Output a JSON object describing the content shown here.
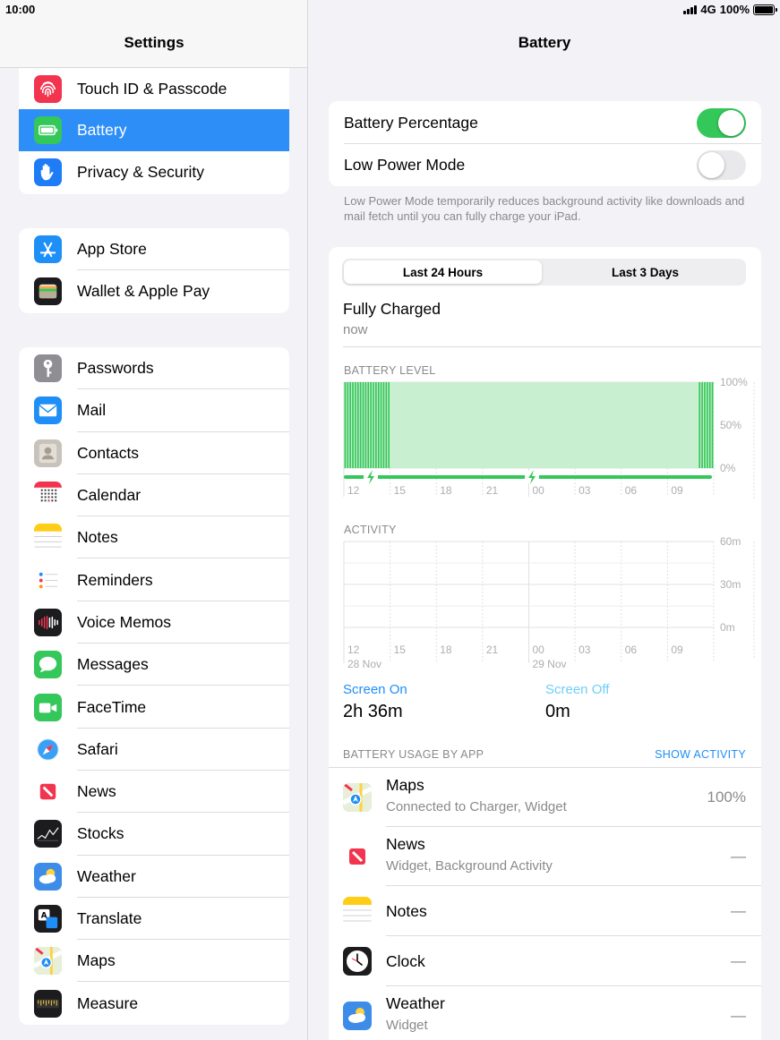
{
  "status_bar": {
    "time": "10:00",
    "network": "4G",
    "battery_percent": "100%"
  },
  "sidebar": {
    "title": "Settings",
    "groups": [
      [
        {
          "label": "Touch ID & Passcode",
          "icon": "fingerprint-icon",
          "color": "#f2344f"
        },
        {
          "label": "Battery",
          "icon": "battery-icon",
          "color": "#34c759",
          "selected": true
        },
        {
          "label": "Privacy & Security",
          "icon": "hand-icon",
          "color": "#1e7cf6"
        }
      ],
      [
        {
          "label": "App Store",
          "icon": "app-store-icon",
          "color": "#1e8ff7"
        },
        {
          "label": "Wallet & Apple Pay",
          "icon": "wallet-icon",
          "color": "#1c1c1e"
        }
      ],
      [
        {
          "label": "Passwords",
          "icon": "key-icon",
          "color": "#8e8e93"
        },
        {
          "label": "Mail",
          "icon": "mail-icon",
          "color": "#1e8ff7"
        },
        {
          "label": "Contacts",
          "icon": "contacts-icon",
          "color": "#c7c3bb"
        },
        {
          "label": "Calendar",
          "icon": "calendar-icon",
          "color": "#ffffff"
        },
        {
          "label": "Notes",
          "icon": "notes-icon",
          "color": "#ffffff"
        },
        {
          "label": "Reminders",
          "icon": "reminders-icon",
          "color": "#ffffff"
        },
        {
          "label": "Voice Memos",
          "icon": "voice-memos-icon",
          "color": "#1c1c1e"
        },
        {
          "label": "Messages",
          "icon": "messages-icon",
          "color": "#34c759"
        },
        {
          "label": "FaceTime",
          "icon": "facetime-icon",
          "color": "#34c759"
        },
        {
          "label": "Safari",
          "icon": "safari-icon",
          "color": "#ffffff"
        },
        {
          "label": "News",
          "icon": "news-icon",
          "color": "#ffffff"
        },
        {
          "label": "Stocks",
          "icon": "stocks-icon",
          "color": "#1c1c1e"
        },
        {
          "label": "Weather",
          "icon": "weather-icon",
          "color": "#3d8de8"
        },
        {
          "label": "Translate",
          "icon": "translate-icon",
          "color": "#1c1c1e"
        },
        {
          "label": "Maps",
          "icon": "maps-icon",
          "color": "#6fd46b"
        },
        {
          "label": "Measure",
          "icon": "measure-icon",
          "color": "#1c1c1e"
        }
      ]
    ]
  },
  "detail": {
    "title": "Battery",
    "battery_percentage_label": "Battery Percentage",
    "battery_percentage_on": true,
    "low_power_label": "Low Power Mode",
    "low_power_on": false,
    "low_power_note": "Low Power Mode temporarily reduces background activity like downloads and mail fetch until you can fully charge your iPad.",
    "segments": [
      "Last 24 Hours",
      "Last 3 Days"
    ],
    "active_segment": 0,
    "charge_status": "Fully Charged",
    "charge_time": "now",
    "battery_level_heading": "BATTERY LEVEL",
    "activity_heading": "ACTIVITY",
    "screen_on_label": "Screen On",
    "screen_on_value": "2h 36m",
    "screen_off_label": "Screen Off",
    "screen_off_value": "0m",
    "usage_heading": "BATTERY USAGE BY APP",
    "show_activity": "SHOW ACTIVITY",
    "apps": [
      {
        "name": "Maps",
        "desc": "Connected to Charger, Widget",
        "value": "100%",
        "icon": "maps-icon"
      },
      {
        "name": "News",
        "desc": "Widget, Background Activity",
        "value": "—",
        "icon": "news-icon"
      },
      {
        "name": "Notes",
        "desc": "",
        "value": "—",
        "icon": "notes-icon"
      },
      {
        "name": "Clock",
        "desc": "",
        "value": "—",
        "icon": "clock-icon"
      },
      {
        "name": "Weather",
        "desc": "Widget",
        "value": "—",
        "icon": "weather-icon"
      }
    ]
  },
  "chart_data": [
    {
      "type": "bar",
      "title": "BATTERY LEVEL",
      "x_ticks": [
        "12",
        "15",
        "18",
        "21",
        "00",
        "03",
        "06",
        "09"
      ],
      "y_ticks": [
        "100%",
        "50%",
        "0%"
      ],
      "ylim": [
        0,
        100
      ],
      "series": [
        {
          "values": [
            100,
            100,
            100,
            100,
            100,
            100,
            100,
            100,
            100,
            100,
            100,
            100,
            100,
            100,
            100,
            100,
            100,
            100,
            100,
            100,
            100,
            100,
            100,
            100
          ]
        }
      ],
      "colors": {
        "bar": "#34c759",
        "area": "#c9efd1",
        "charging": "#34c759"
      }
    },
    {
      "type": "bar",
      "title": "ACTIVITY",
      "x_ticks": [
        "12",
        "15",
        "18",
        "21",
        "00",
        "03",
        "06",
        "09"
      ],
      "x_dates": [
        "28 Nov",
        "29 Nov"
      ],
      "y_ticks": [
        "60m",
        "30m",
        "0m"
      ],
      "ylim": [
        0,
        60
      ],
      "series": [
        {
          "values": [
            0,
            0,
            0,
            0,
            0,
            0,
            0,
            0,
            0,
            0,
            0,
            0,
            0,
            0,
            0,
            0,
            0,
            0,
            0,
            0,
            0,
            0,
            0,
            0
          ]
        }
      ]
    }
  ]
}
